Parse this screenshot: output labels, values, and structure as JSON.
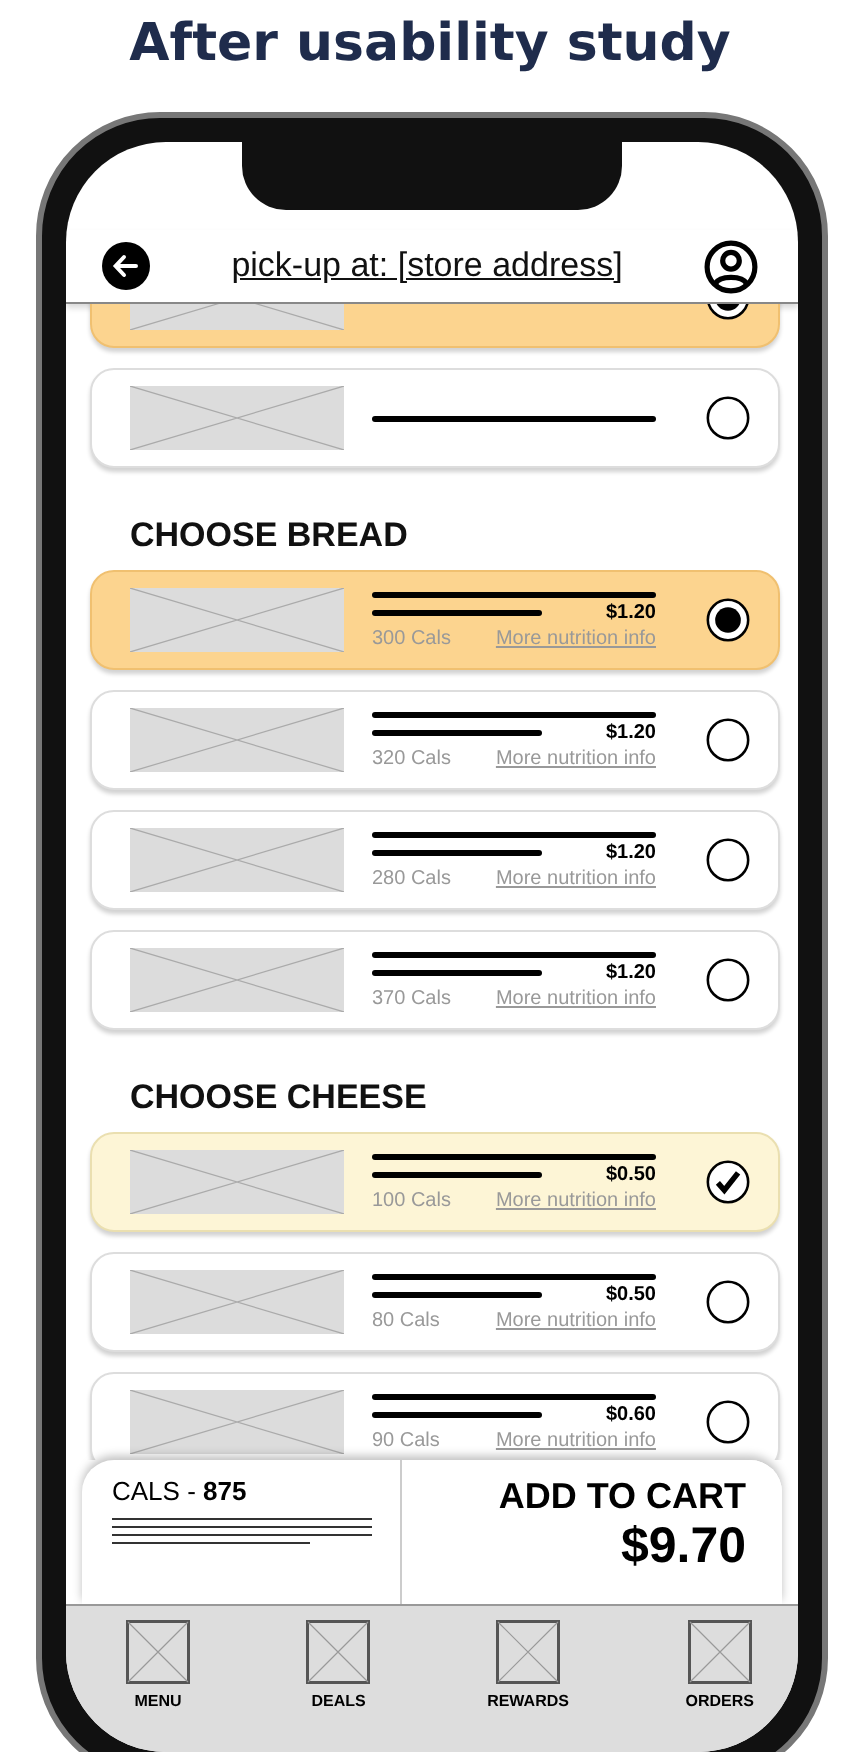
{
  "page_title": "After usability study",
  "header": {
    "title": "pick-up at: [store address]"
  },
  "sections": [
    {
      "kind": "radio",
      "items": [
        {
          "selected": true
        },
        {
          "selected": false
        }
      ]
    },
    {
      "kind": "radio",
      "title": "CHOOSE BREAD",
      "items": [
        {
          "price": "$1.20",
          "cals": "300 Cals",
          "link": "More nutrition info",
          "selected": true
        },
        {
          "price": "$1.20",
          "cals": "320 Cals",
          "link": "More nutrition info",
          "selected": false
        },
        {
          "price": "$1.20",
          "cals": "280 Cals",
          "link": "More nutrition info",
          "selected": false
        },
        {
          "price": "$1.20",
          "cals": "370 Cals",
          "link": "More nutrition info",
          "selected": false
        }
      ]
    },
    {
      "kind": "check",
      "title": "CHOOSE CHEESE",
      "items": [
        {
          "price": "$0.50",
          "cals": "100 Cals",
          "link": "More nutrition info",
          "selected": true
        },
        {
          "price": "$0.50",
          "cals": "80 Cals",
          "link": "More nutrition info",
          "selected": false
        },
        {
          "price": "$0.60",
          "cals": "90 Cals",
          "link": "More nutrition info",
          "selected": false
        }
      ]
    }
  ],
  "cart": {
    "cals": "CALS - **875**",
    "button": "ADD TO CART",
    "total": "$9.70"
  },
  "nav": [
    "MENU",
    "DEALS",
    "REWARDS",
    "ORDERS"
  ]
}
